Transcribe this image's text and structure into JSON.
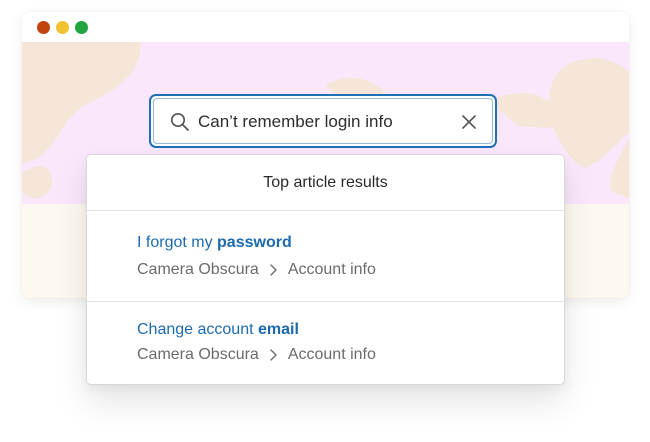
{
  "window": {
    "controls": [
      "close",
      "minimize",
      "maximize"
    ]
  },
  "search": {
    "value": "Can’t remember login info",
    "icon": "search-icon",
    "clear_icon": "close-icon"
  },
  "dropdown": {
    "header": "Top article results",
    "results": [
      {
        "title_prefix": "I forgot my ",
        "title_highlight": "password",
        "breadcrumb": [
          "Camera Obscura",
          "Account info"
        ]
      },
      {
        "title_prefix": "Change account ",
        "title_highlight": "email",
        "breadcrumb": [
          "Camera Obscura",
          "Account info"
        ]
      }
    ]
  },
  "colors": {
    "accent": "#1e6fb8",
    "link": "#1c6ab0",
    "hero_background": "#fae7fb",
    "hero_shapes": "#f5e6d8",
    "lower_background": "#fef9f0",
    "close_dot": "#c1440e",
    "minimize_dot": "#f2c230",
    "maximize_dot": "#1fa53f"
  }
}
